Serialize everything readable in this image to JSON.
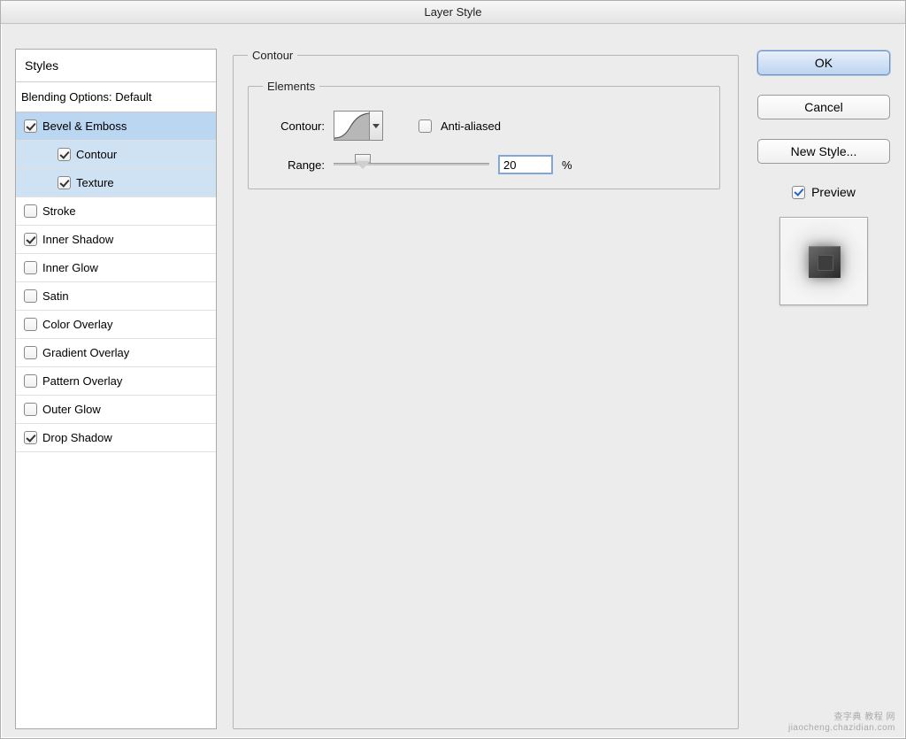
{
  "window": {
    "title": "Layer Style"
  },
  "sidebar": {
    "header": "Styles",
    "category": "Blending Options: Default",
    "items": [
      {
        "label": "Bevel & Emboss",
        "checked": true,
        "selected": true,
        "sub": false
      },
      {
        "label": "Contour",
        "checked": true,
        "selected": true,
        "sub": true
      },
      {
        "label": "Texture",
        "checked": true,
        "selected": true,
        "sub": true
      },
      {
        "label": "Stroke",
        "checked": false,
        "selected": false,
        "sub": false
      },
      {
        "label": "Inner Shadow",
        "checked": true,
        "selected": false,
        "sub": false
      },
      {
        "label": "Inner Glow",
        "checked": false,
        "selected": false,
        "sub": false
      },
      {
        "label": "Satin",
        "checked": false,
        "selected": false,
        "sub": false
      },
      {
        "label": "Color Overlay",
        "checked": false,
        "selected": false,
        "sub": false
      },
      {
        "label": "Gradient Overlay",
        "checked": false,
        "selected": false,
        "sub": false
      },
      {
        "label": "Pattern Overlay",
        "checked": false,
        "selected": false,
        "sub": false
      },
      {
        "label": "Outer Glow",
        "checked": false,
        "selected": false,
        "sub": false
      },
      {
        "label": "Drop Shadow",
        "checked": true,
        "selected": false,
        "sub": false
      }
    ]
  },
  "main": {
    "group_title": "Contour",
    "elements_title": "Elements",
    "contour_label": "Contour:",
    "anti_aliased_label": "Anti-aliased",
    "anti_aliased_checked": false,
    "range_label": "Range:",
    "range_value": "20",
    "range_unit": "%"
  },
  "buttons": {
    "ok": "OK",
    "cancel": "Cancel",
    "new_style": "New Style..."
  },
  "preview": {
    "label": "Preview",
    "checked": true
  },
  "watermark": {
    "line1": "查字典  教程 网",
    "line2": "jiaocheng.chazidian.com"
  }
}
